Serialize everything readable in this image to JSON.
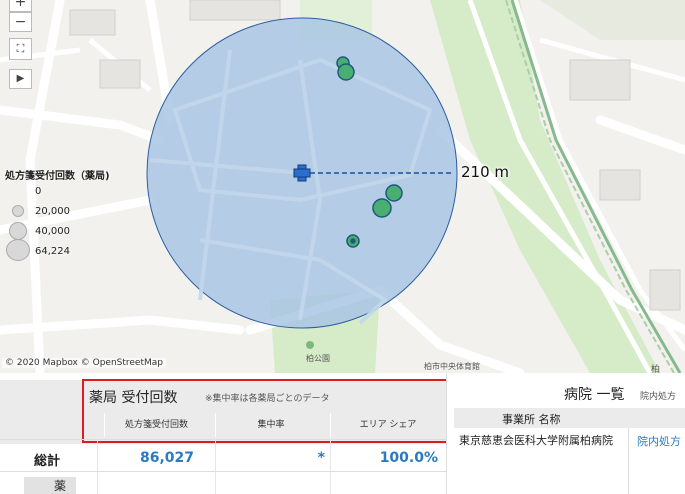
{
  "map": {
    "controls": {
      "zoom_in": "+",
      "zoom_out": "−",
      "lasso": "⛶",
      "play": "▶"
    },
    "legend": {
      "title": "処方箋受付回数（薬局)",
      "entries": [
        "0",
        "20,000",
        "40,000",
        "64,224"
      ]
    },
    "radius_label": "210 m",
    "attribution": "© 2020 Mapbox © OpenStreetMap",
    "park_label": "柏公園",
    "gym_label": "柏市中央体育館",
    "side_label": "柏",
    "colors": {
      "buffer_fill": "#a9c6e3",
      "buffer_stroke": "#2c5fa0",
      "marker": "#4aae73"
    }
  },
  "pharmacy": {
    "title": "薬局 受付回数",
    "note": "※集中率は各薬局ごとのデータ",
    "columns": [
      "処方箋受付回数",
      "集中率",
      "エリア シェア"
    ],
    "total_label": "総計",
    "total_values": [
      "86,027",
      "*",
      "100.0%"
    ],
    "sub_label": "薬局"
  },
  "hospital": {
    "title": "病院 一覧",
    "subtitle": "院内処方",
    "column_name": "事業所 名称",
    "row_name": "東京慈恵会医科大学附属柏病院",
    "row_link": "院内処方"
  }
}
